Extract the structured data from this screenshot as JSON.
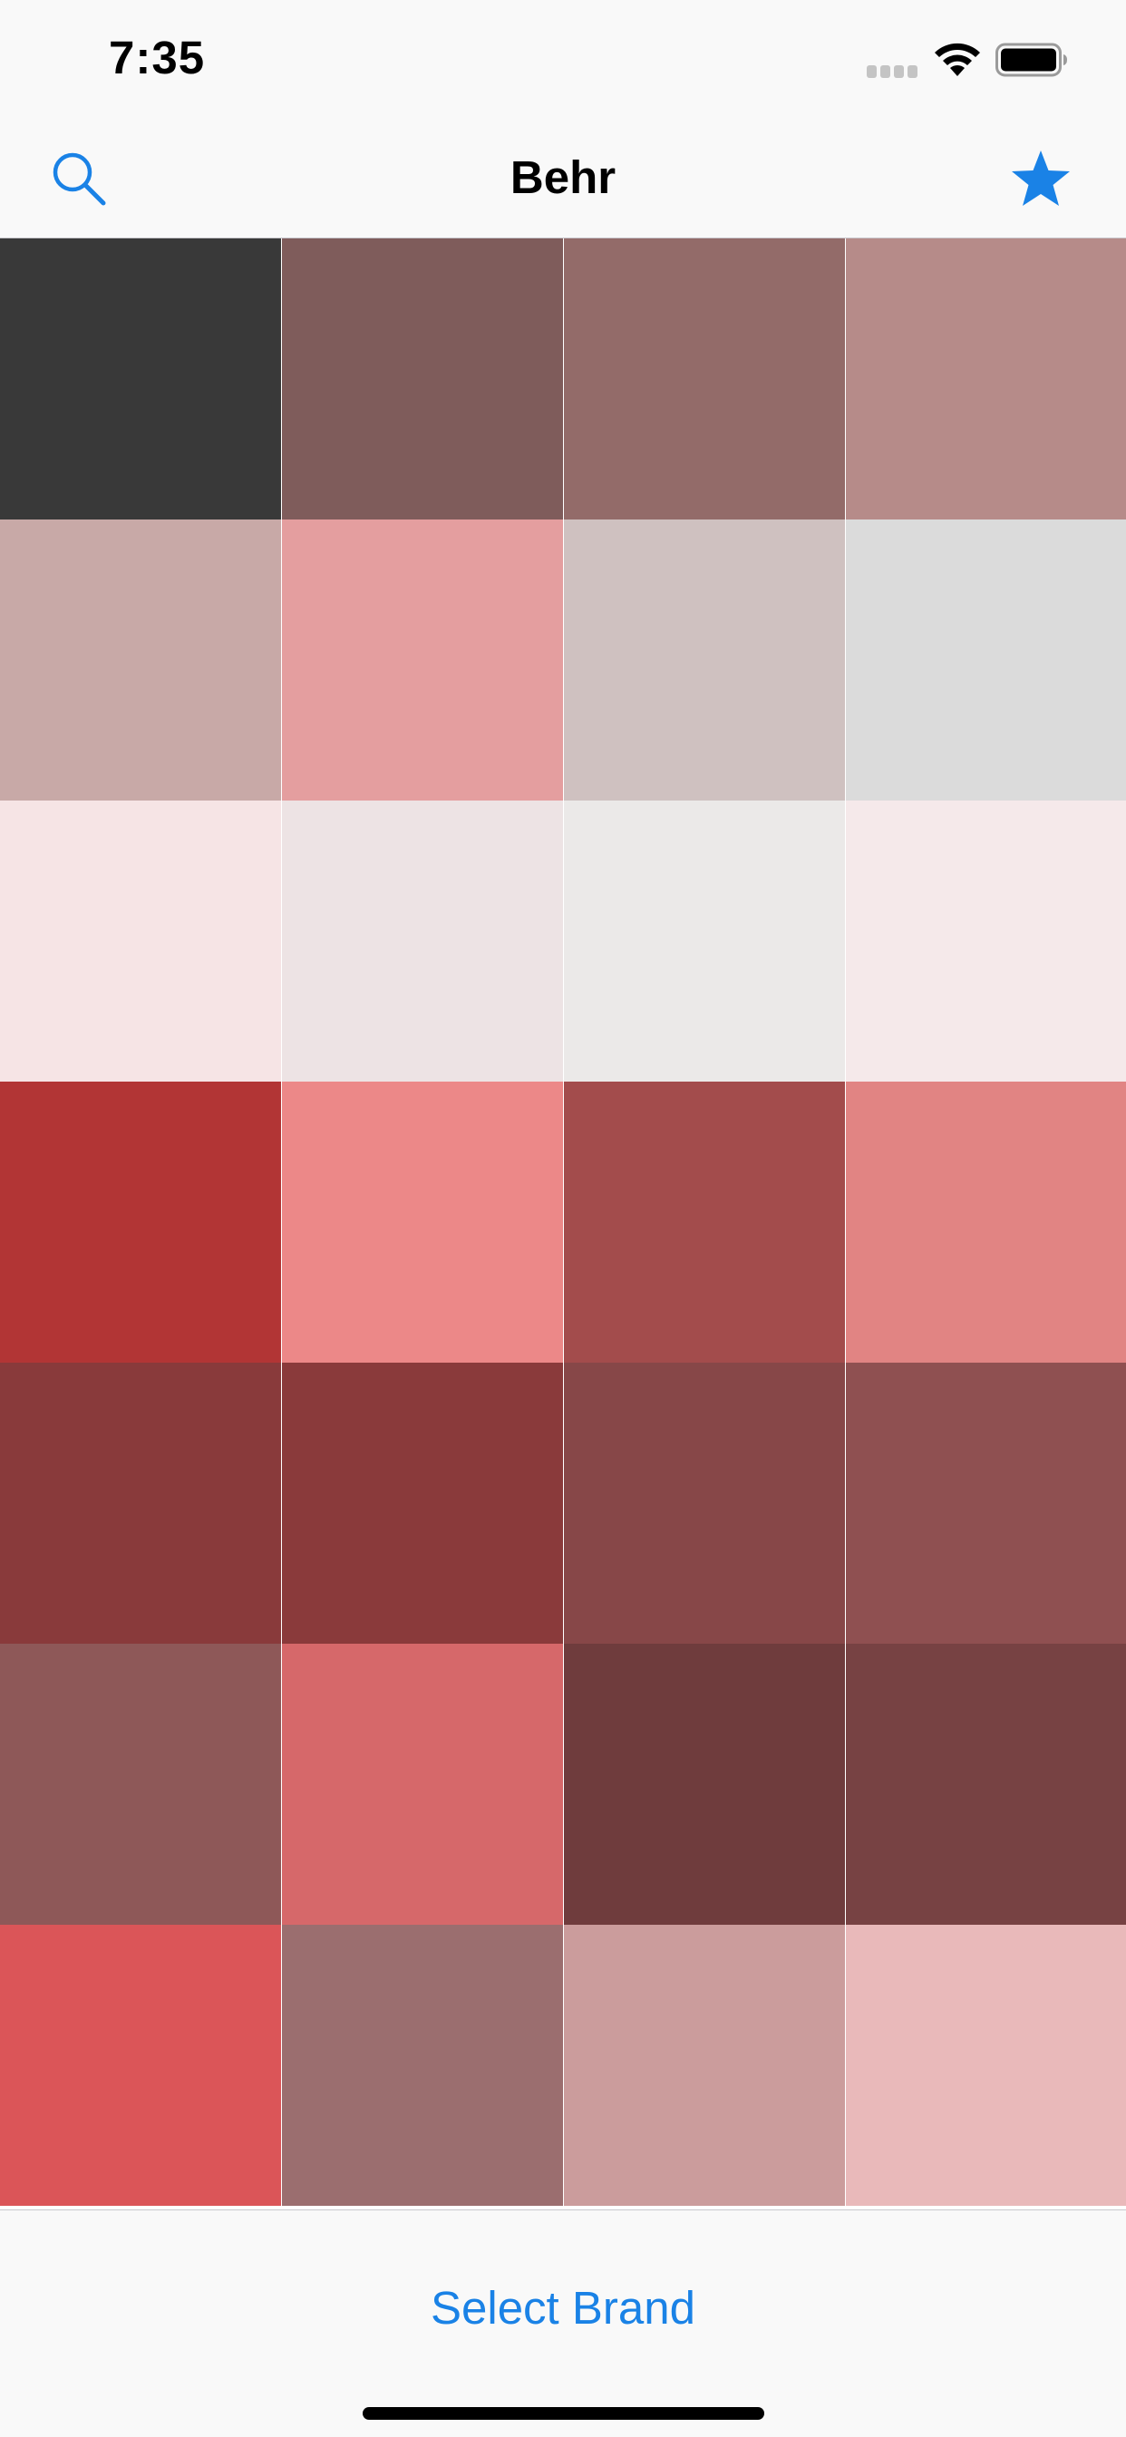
{
  "status_bar": {
    "time": "7:35"
  },
  "nav": {
    "title": "Behr",
    "search_icon": "search-icon",
    "favorites_icon": "star-icon"
  },
  "swatches": [
    "#393939",
    "#7f5c5b",
    "#936b69",
    "#b68b89",
    "#c8a9a7",
    "#e49e9f",
    "#cfc1c0",
    "#dbdbdb",
    "#f6e4e5",
    "#ede3e4",
    "#ebe9e8",
    "#f5e9ea",
    "#b23535",
    "#ec8888",
    "#a34c4c",
    "#e18483",
    "#893a3b",
    "#8a3a3b",
    "#874748",
    "#8f5051",
    "#8e5858",
    "#d6686a",
    "#6f3c3d",
    "#774243",
    "#db5558",
    "#9b6e6f",
    "#cb9c9c",
    "#e9b9ba"
  ],
  "toolbar": {
    "select_brand_label": "Select Brand"
  },
  "colors": {
    "accent": "#1a82e6",
    "background": "#f9f9f9"
  }
}
